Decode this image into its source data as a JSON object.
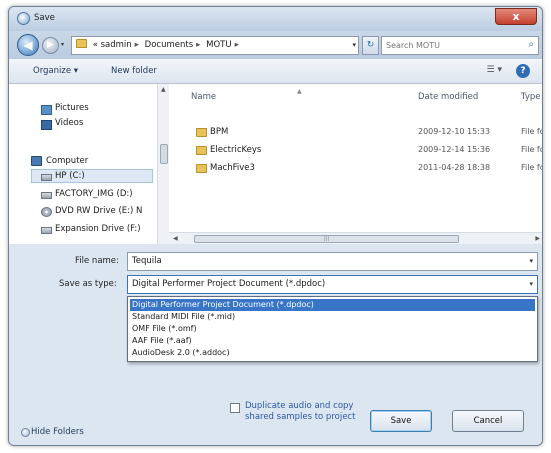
{
  "window": {
    "title": "Save",
    "close_label": "x"
  },
  "navbar": {
    "back_glyph": "◀",
    "forward_glyph": "▶",
    "recent_glyph": "▾",
    "breadcrumb": [
      "«",
      "sadmin",
      "Documents",
      "MOTU"
    ],
    "refresh_glyph": "↻",
    "search_placeholder": "Search MOTU"
  },
  "toolbar": {
    "organize_label": "Organize ▾",
    "new_folder_label": "New folder",
    "view_glyph": "☰ ▾",
    "help_glyph": "?"
  },
  "nav_pane": {
    "items": [
      {
        "label": "Pictures",
        "icon": "pictures-icon"
      },
      {
        "label": "Videos",
        "icon": "videos-icon"
      },
      {
        "label": "Computer",
        "icon": "computer-icon"
      },
      {
        "label": "HP (C:)",
        "icon": "drive-icon"
      },
      {
        "label": "FACTORY_IMG (D:)",
        "icon": "drive-icon"
      },
      {
        "label": "DVD RW Drive (E:) N",
        "icon": "dvd-icon"
      },
      {
        "label": "Expansion Drive (F:)",
        "icon": "drive-icon"
      }
    ]
  },
  "file_list": {
    "columns": {
      "name": "Name",
      "date": "Date modified",
      "type": "Type"
    },
    "rows": [
      {
        "name": "BPM",
        "date": "2009-12-10 15:33",
        "type": "File fol"
      },
      {
        "name": "ElectricKeys",
        "date": "2009-12-14 15:36",
        "type": "File fol"
      },
      {
        "name": "MachFive3",
        "date": "2011-04-28 18:38",
        "type": "File fol"
      }
    ]
  },
  "form": {
    "file_name_label": "File name:",
    "file_name_value": "Tequila",
    "save_type_label": "Save as type:",
    "save_type_value": "Digital Performer Project Document (*.dpdoc)",
    "type_options": [
      "Digital Performer Project Document (*.dpdoc)",
      "Standard MIDI File (*.mid)",
      "OMF File (*.omf)",
      "AAF File (*.aaf)",
      "AudioDesk 2.0 (*.addoc)"
    ],
    "duplicate_label": "Duplicate audio and copy shared samples to project",
    "save_button": "Save",
    "cancel_button": "Cancel",
    "hide_folders": "Hide Folders"
  }
}
